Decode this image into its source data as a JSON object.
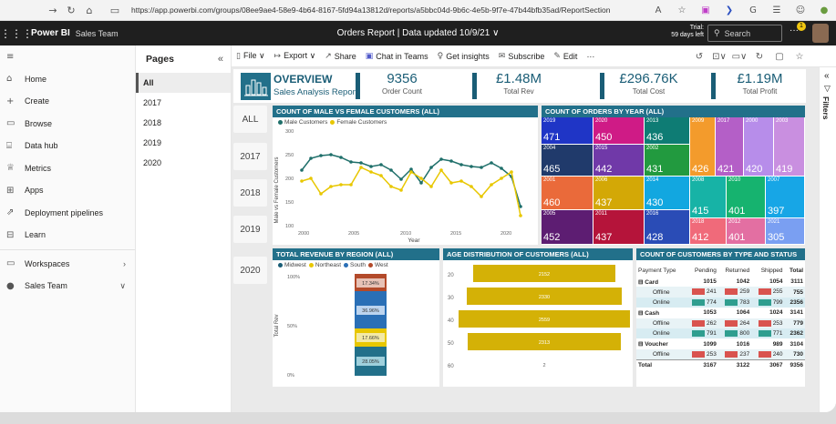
{
  "browser": {
    "url": "https://app.powerbi.com/groups/08ee9ae4-58e9-4b64-8167-5fd94a13812d/reports/a5bbc04d-9b6c-4e5b-9f7e-47b44bfb35ad/ReportSection"
  },
  "header": {
    "brand": "Power BI",
    "workspace": "Sales Team",
    "report_title": "Orders Report  |  Data updated 10/9/21 ∨",
    "trial_line1": "Trial:",
    "trial_line2": "59 days left",
    "search_placeholder": "Search",
    "notification_count": "1"
  },
  "nav": {
    "items": [
      {
        "label": "Home",
        "icon": "home-icon"
      },
      {
        "label": "Create",
        "icon": "plus-icon"
      },
      {
        "label": "Browse",
        "icon": "folder-icon"
      },
      {
        "label": "Data hub",
        "icon": "database-icon"
      },
      {
        "label": "Metrics",
        "icon": "trophy-icon"
      },
      {
        "label": "Apps",
        "icon": "apps-icon"
      },
      {
        "label": "Deployment pipelines",
        "icon": "rocket-icon"
      },
      {
        "label": "Learn",
        "icon": "book-icon"
      }
    ],
    "workspaces_label": "Workspaces",
    "team_label": "Sales Team"
  },
  "pages": {
    "title": "Pages",
    "items": [
      "All",
      "2017",
      "2018",
      "2019",
      "2020"
    ],
    "active": "All"
  },
  "toolbar": {
    "file": "File ∨",
    "export": "Export ∨",
    "share": "Share",
    "chat": "Chat in Teams",
    "insights": "Get insights",
    "subscribe": "Subscribe",
    "edit": "Edit",
    "more": "···"
  },
  "filters_label": "Filters",
  "report_nav": [
    "ALL",
    "2017",
    "2018",
    "2019",
    "2020"
  ],
  "overview": {
    "title": "OVERVIEW",
    "subtitle": "Sales Analysis Report",
    "kpis": [
      {
        "value": "9356",
        "label": "Order Count"
      },
      {
        "value": "£1.48M",
        "label": "Total Rev"
      },
      {
        "value": "£296.76K",
        "label": "Total Cost"
      },
      {
        "value": "£1.19M",
        "label": "Total Profit"
      }
    ]
  },
  "colors": {
    "teal": "#1f6f6a",
    "gold": "#e8c700",
    "header": "#22708a",
    "navy": "#1a5d76"
  },
  "line_chart": {
    "title": "COUNT OF MALE VS FEMALE CUSTOMERS (ALL)",
    "legend": [
      "Male Customers",
      "Female Customers"
    ],
    "ylabel": "Male vs Female Customers",
    "xlabel": "Year",
    "yticks": [
      "300",
      "250",
      "200",
      "150",
      "100"
    ],
    "xticks": [
      "2000",
      "2005",
      "2010",
      "2015",
      "2020"
    ]
  },
  "treemap": {
    "title": "COUNT OF ORDERS BY YEAR (ALL)",
    "cells": [
      {
        "year": "2019",
        "count": "471",
        "color": "#1f35c6"
      },
      {
        "year": "2020",
        "count": "450",
        "color": "#cf1b86"
      },
      {
        "year": "2013",
        "count": "436",
        "color": "#0e7c74"
      },
      {
        "year": "2004",
        "count": "465",
        "color": "#203a6b"
      },
      {
        "year": "2015",
        "count": "442",
        "color": "#7039a8"
      },
      {
        "year": "2002",
        "count": "431",
        "color": "#229a3f"
      },
      {
        "year": "2001",
        "count": "460",
        "color": "#ea6a3a"
      },
      {
        "year": "2006",
        "count": "437",
        "color": "#d3a806"
      },
      {
        "year": "2014",
        "count": "430",
        "color": "#12a7e0"
      },
      {
        "year": "2005",
        "count": "452",
        "color": "#5d1d72"
      },
      {
        "year": "2011",
        "count": "437",
        "color": "#b5143a"
      },
      {
        "year": "2016",
        "count": "428",
        "color": "#2a4cb6"
      },
      {
        "year": "2009",
        "count": "426",
        "color": "#f39b2c"
      },
      {
        "year": "2017",
        "count": "421",
        "color": "#b45fc7"
      },
      {
        "year": "2000",
        "count": "420",
        "color": "#b78dea"
      },
      {
        "year": "2003",
        "count": "419",
        "color": "#c98fe0"
      },
      {
        "year": "2008",
        "count": "415",
        "color": "#17b3a6"
      },
      {
        "year": "2010",
        "count": "401",
        "color": "#16b36f"
      },
      {
        "year": "2007",
        "count": "397",
        "color": "#17a6e6"
      },
      {
        "year": "2018",
        "count": "412",
        "color": "#f06a7a"
      },
      {
        "year": "2012",
        "count": "401",
        "color": "#e36fa2"
      },
      {
        "year": "2021",
        "count": "305",
        "color": "#7a9ff2"
      }
    ]
  },
  "revenue": {
    "title": "TOTAL REVENUE BY REGION (ALL)",
    "legend": [
      "Midwest",
      "Northeast",
      "South",
      "West"
    ],
    "ylabel": "Total Rev",
    "yticks": [
      "100%",
      "50%",
      "0%"
    ],
    "labels": [
      "28.05%",
      "17.66%",
      "36.96%",
      "17.34%"
    ]
  },
  "age": {
    "title": "AGE DISTRIBUTION OF CUSTOMERS (ALL)",
    "labels": [
      "20",
      "30",
      "40",
      "50",
      "60"
    ],
    "values": [
      "2152",
      "2330",
      "2559",
      "2313",
      "2"
    ]
  },
  "customers": {
    "title": "COUNT OF CUSTOMERS BY TYPE AND STATUS",
    "headers": [
      "Payment Type",
      "Pending",
      "Returned",
      "Shipped",
      "Total"
    ],
    "rows": [
      {
        "type": "⊟ Card",
        "p": "1015",
        "r": "1042",
        "s": "1054",
        "t": "3111",
        "group": true
      },
      {
        "type": "Offline",
        "p": "241",
        "r": "259",
        "s": "255",
        "t": "755"
      },
      {
        "type": "Online",
        "p": "774",
        "r": "783",
        "s": "799",
        "t": "2356"
      },
      {
        "type": "⊟ Cash",
        "p": "1053",
        "r": "1064",
        "s": "1024",
        "t": "3141",
        "group": true
      },
      {
        "type": "Offline",
        "p": "262",
        "r": "264",
        "s": "253",
        "t": "779"
      },
      {
        "type": "Online",
        "p": "791",
        "r": "800",
        "s": "771",
        "t": "2362"
      },
      {
        "type": "⊟ Voucher",
        "p": "1099",
        "r": "1016",
        "s": "989",
        "t": "3104",
        "group": true
      },
      {
        "type": "Offline",
        "p": "253",
        "r": "237",
        "s": "240",
        "t": "730"
      },
      {
        "type": "Total",
        "p": "3167",
        "r": "3122",
        "s": "3067",
        "t": "9356",
        "group": true
      }
    ]
  }
}
